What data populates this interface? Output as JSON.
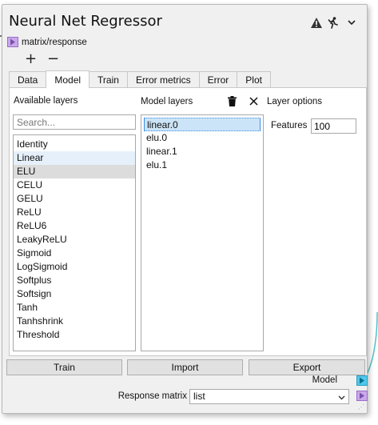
{
  "window": {
    "title": "Neural Net Regressor",
    "header_icons": [
      "warning-icon",
      "run-icon",
      "chevron-down-icon"
    ]
  },
  "input_port": {
    "label": "matrix/response"
  },
  "controls": {
    "add_label": "+",
    "remove_label": "−"
  },
  "tabs": [
    {
      "label": "Data",
      "active": false
    },
    {
      "label": "Model",
      "active": true
    },
    {
      "label": "Train",
      "active": false
    },
    {
      "label": "Error metrics",
      "active": false
    },
    {
      "label": "Error",
      "active": false
    },
    {
      "label": "Plot",
      "active": false
    }
  ],
  "available_layers": {
    "label": "Available layers",
    "search_placeholder": "Search...",
    "items": [
      "Identity",
      "Linear",
      "ELU",
      "CELU",
      "GELU",
      "ReLU",
      "ReLU6",
      "LeakyReLU",
      "Sigmoid",
      "LogSigmoid",
      "Softplus",
      "Softsign",
      "Tanh",
      "Tanhshrink",
      "Threshold"
    ],
    "hover_index": 1,
    "selected_index": 2
  },
  "model_layers": {
    "label": "Model layers",
    "items": [
      "linear.0",
      "elu.0",
      "linear.1",
      "elu.1"
    ],
    "selected_index": 0
  },
  "layer_options": {
    "label": "Layer options",
    "features_label": "Features",
    "features_value": "100"
  },
  "buttons": {
    "train": "Train",
    "import": "Import",
    "export": "Export"
  },
  "outputs": {
    "model_label": "Model",
    "response_matrix_label": "Response matrix",
    "response_matrix_value": "list"
  },
  "colors": {
    "input_port": "#c9a8e8",
    "model_port": "#52c7e8",
    "response_port": "#c9a8e8",
    "selection": "#cce4f7"
  }
}
